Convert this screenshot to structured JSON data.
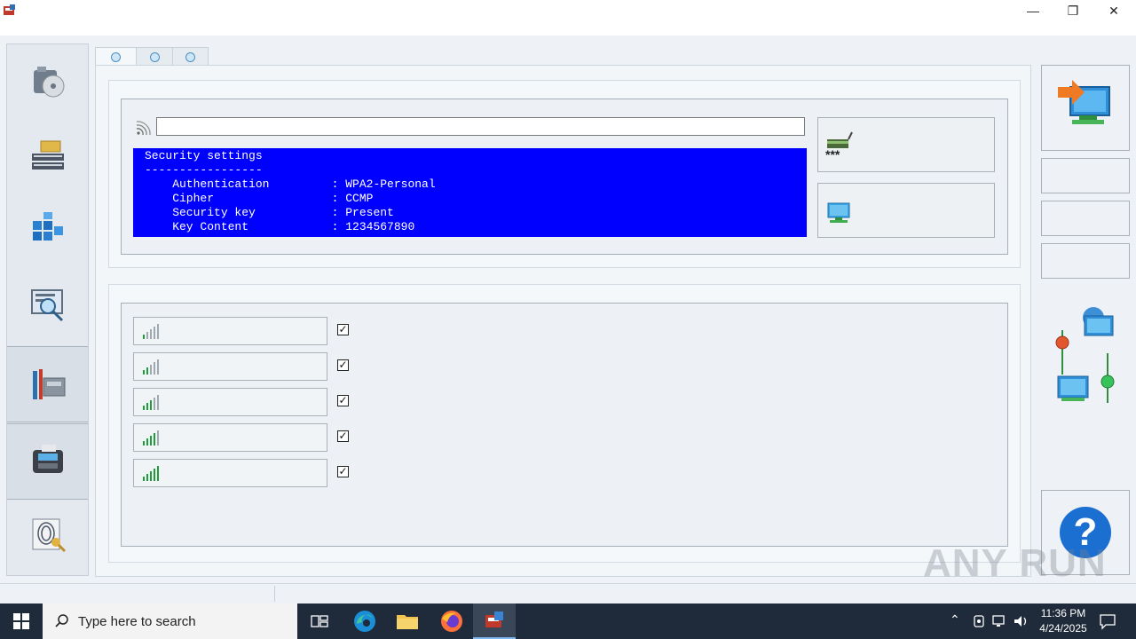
{
  "window": {
    "minimize_glyph": "—",
    "restore_glyph": "❐",
    "close_glyph": "✕"
  },
  "left_nav": {
    "items": [
      {
        "icon": "camera-disc-icon"
      },
      {
        "icon": "server-stack-icon"
      },
      {
        "icon": "cube-blocks-icon"
      },
      {
        "icon": "monitor-magnifier-icon"
      },
      {
        "icon": "tools-computer-icon"
      },
      {
        "icon": "card-terminal-icon"
      },
      {
        "icon": "fingerprint-key-icon"
      }
    ]
  },
  "tabs": [
    {
      "icon": "tab-dot-icon"
    },
    {
      "icon": "tab-dot-icon"
    },
    {
      "icon": "tab-dot-icon"
    }
  ],
  "wifi_section": {
    "ssid_value": "",
    "security_text": "Security settings\n-----------------\n    Authentication         : WPA2-Personal\n    Cipher                 : CCMP\n    Security key           : Present\n    Key Content            : 1234567890"
  },
  "signal_rows": [
    {
      "bars": 1,
      "checked": true,
      "check_glyph": "✓"
    },
    {
      "bars": 2,
      "checked": true,
      "check_glyph": "✓"
    },
    {
      "bars": 3,
      "checked": true,
      "check_glyph": "✓"
    },
    {
      "bars": 4,
      "checked": true,
      "check_glyph": "✓"
    },
    {
      "bars": 5,
      "checked": true,
      "check_glyph": "✓"
    }
  ],
  "right_rail": {
    "help_glyph": "?"
  },
  "taskbar": {
    "search_placeholder": "Type here to search",
    "time": "11:36 PM",
    "date": "4/24/2025"
  },
  "watermark": "ANY RUN",
  "colors": {
    "security_bg": "#0000ff",
    "taskbar_bg": "#1f2b3a",
    "signal_green": "#1e9e3a"
  }
}
